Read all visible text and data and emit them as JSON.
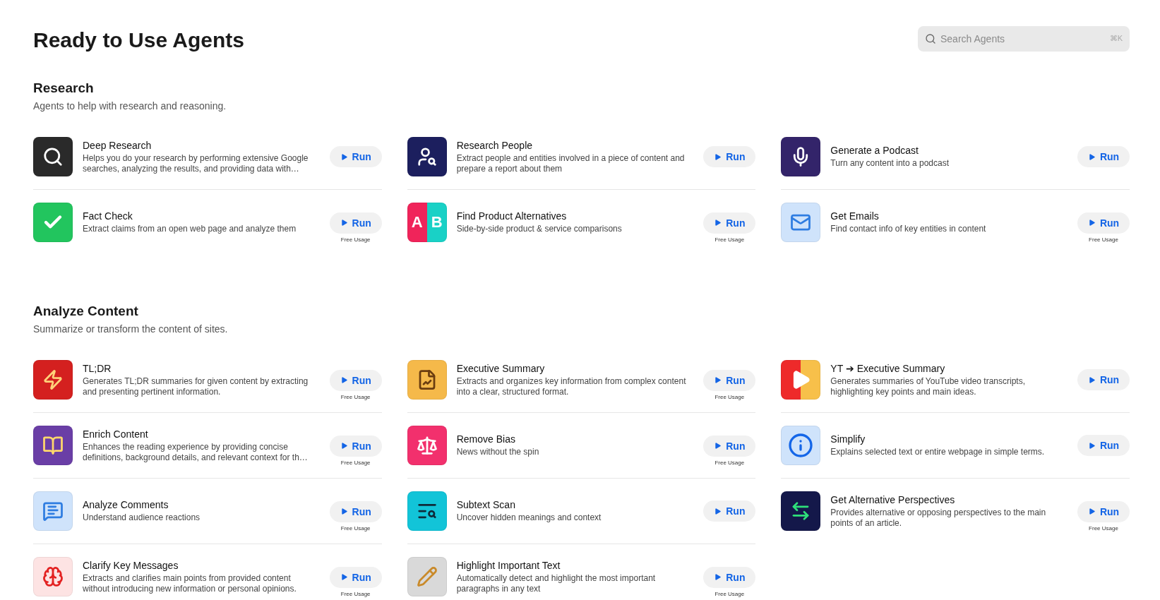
{
  "page_title": "Ready to Use Agents",
  "search": {
    "placeholder": "Search Agents",
    "shortcut": "⌘K"
  },
  "sections": [
    {
      "title": "Research",
      "subtitle": "Agents to help with research and reasoning.",
      "columns": [
        [
          {
            "name": "Deep Research",
            "description": "Helps you do your research by performing extensive Google searches, analyzing the results, and providing data with…",
            "button": "Run"
          },
          {
            "name": "Fact Check",
            "description": "Extract claims from an open web page and analyze them",
            "button": "Run",
            "note": "Free Usage"
          }
        ],
        [
          {
            "name": "Research People",
            "description": "Extract people and entities involved in a piece of content and prepare a report about them",
            "button": "Run"
          },
          {
            "name": "Find Product Alternatives",
            "description": "Side-by-side product & service comparisons",
            "button": "Run",
            "note": "Free Usage",
            "icon_letters": [
              "A",
              "B"
            ]
          }
        ],
        [
          {
            "name": "Generate a Podcast",
            "description": "Turn any content into a podcast",
            "button": "Run"
          },
          {
            "name": "Get Emails",
            "description": "Find contact info of key entities in content",
            "button": "Run",
            "note": "Free Usage"
          }
        ]
      ]
    },
    {
      "title": "Analyze Content",
      "subtitle": "Summarize or transform the content of sites.",
      "columns": [
        [
          {
            "name": "TL;DR",
            "description": "Generates TL;DR summaries for given content by extracting and presenting pertinent information.",
            "button": "Run",
            "note": "Free Usage"
          },
          {
            "name": "Enrich Content",
            "description": "Enhances the reading experience by providing concise definitions, background details, and relevant context for th…",
            "button": "Run",
            "note": "Free Usage"
          },
          {
            "name": "Analyze Comments",
            "description": "Understand audience reactions",
            "button": "Run",
            "note": "Free Usage"
          },
          {
            "name": "Clarify Key Messages",
            "description": "Extracts and clarifies main points from provided content without introducing new information or personal opinions.",
            "button": "Run",
            "note": "Free Usage"
          }
        ],
        [
          {
            "name": "Executive Summary",
            "description": "Extracts and organizes key information from complex content into a clear, structured format.",
            "button": "Run",
            "note": "Free Usage"
          },
          {
            "name": "Remove Bias",
            "description": "News without the spin",
            "button": "Run",
            "note": "Free Usage"
          },
          {
            "name": "Subtext Scan",
            "description": "Uncover hidden meanings and context",
            "button": "Run"
          },
          {
            "name": "Highlight Important Text",
            "description": "Automatically detect and highlight the most important paragraphs in any text",
            "button": "Run",
            "note": "Free Usage"
          }
        ],
        [
          {
            "name": "YT ➔ Executive Summary",
            "description": "Generates summaries of YouTube video transcripts, highlighting key points and main ideas.",
            "button": "Run"
          },
          {
            "name": "Simplify",
            "description": "Explains selected text or entire webpage in simple terms.",
            "button": "Run"
          },
          {
            "name": "Get Alternative Perspectives",
            "description": "Provides alternative or opposing perspectives to the main points of an article.",
            "button": "Run",
            "note": "Free Usage"
          }
        ]
      ]
    }
  ]
}
